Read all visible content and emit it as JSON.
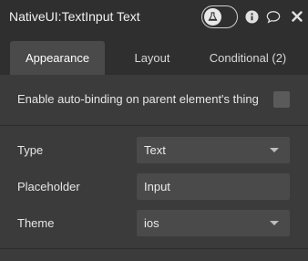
{
  "header": {
    "title": "NativeUI:TextInput Text",
    "icons": [
      "flask-icon",
      "info-icon",
      "comment-icon",
      "close-icon"
    ]
  },
  "tabs": [
    {
      "label": "Appearance",
      "active": true
    },
    {
      "label": "Layout",
      "active": false
    },
    {
      "label": "Conditional (2)",
      "active": false
    }
  ],
  "appearance": {
    "auto_binding_label": "Enable auto-binding on parent element's thing",
    "auto_binding_checked": false,
    "fields": {
      "type": {
        "label": "Type",
        "value": "Text"
      },
      "placeholder": {
        "label": "Placeholder",
        "value": "Input"
      },
      "theme": {
        "label": "Theme",
        "value": "ios"
      }
    }
  },
  "colors": {
    "header_bg": "#2f2f2f",
    "panel_bg": "#3b3b3b",
    "field_bg": "#4a4a4a"
  }
}
